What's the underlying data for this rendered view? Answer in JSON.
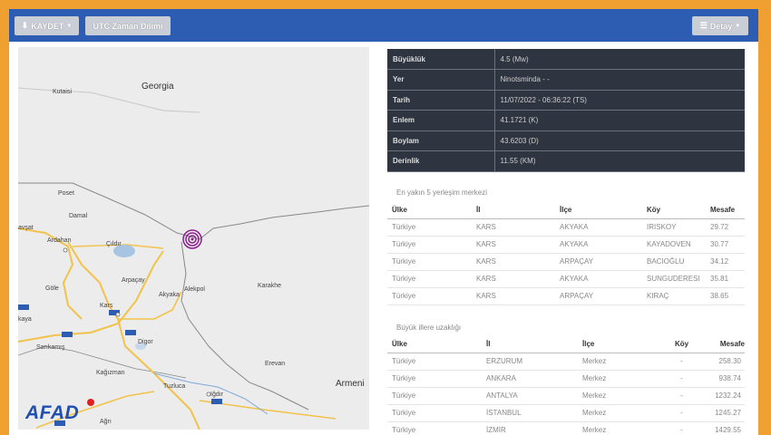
{
  "toolbar": {
    "save_label": "KAYDET",
    "utc_label": "UTC Zaman Dilimi",
    "detail_label": "Detay"
  },
  "map": {
    "labels": {
      "georgia": "Georgia",
      "kutaisi": "Kutaisi",
      "poset": "Poset",
      "damal": "Damal",
      "ardahan": "Ardahan",
      "cildir": "Çıldır",
      "arpacay": "Arpaçay",
      "akyaka": "Akyaka",
      "alaverdi": "Alekpol",
      "karakhe": "Karakhe",
      "gole": "Göle",
      "kars": "Kars",
      "sarikamis": "Sarıkamış",
      "digor": "Digor",
      "kagizman": "Kağızman",
      "tuzluca": "Tuzluca",
      "igdir": "Iğdır",
      "yerevan": "Erevan",
      "armenia": "Armeni",
      "agri": "Ağrı",
      "hanak": "Hanak",
      "posof_left": "avşat",
      "city": "kaya"
    },
    "logo": "AFAD"
  },
  "info": [
    {
      "key": "Büyüklük",
      "value": "4.5 (Mw)"
    },
    {
      "key": "Yer",
      "value": "Ninotsminda - -"
    },
    {
      "key": "Tarih",
      "value": "11/07/2022 - 06:36:22 (TS)"
    },
    {
      "key": "Enlem",
      "value": "41.1721 (K)"
    },
    {
      "key": "Boylam",
      "value": "43.6203 (D)"
    },
    {
      "key": "Derinlik",
      "value": "11.55 (KM)"
    }
  ],
  "nearest": {
    "title": "En yakın 5 yerleşim merkezi",
    "headers": [
      "Ülke",
      "İl",
      "İlçe",
      "Köy",
      "Mesafe"
    ],
    "rows": [
      [
        "Türkiye",
        "KARS",
        "AKYAKA",
        "IRISKOY",
        "29.72"
      ],
      [
        "Türkiye",
        "KARS",
        "AKYAKA",
        "KAYADOVEN",
        "30.77"
      ],
      [
        "Türkiye",
        "KARS",
        "ARPAÇAY",
        "BACIOĞLU",
        "34.12"
      ],
      [
        "Türkiye",
        "KARS",
        "AKYAKA",
        "SUNGUDERESI",
        "35.81"
      ],
      [
        "Türkiye",
        "KARS",
        "ARPAÇAY",
        "KIRAÇ",
        "38.65"
      ]
    ]
  },
  "cities": {
    "title": "Büyük illere uzaklığı",
    "headers": [
      "Ülke",
      "İl",
      "İlçe",
      "Köy",
      "Mesafe"
    ],
    "rows": [
      [
        "Türkiye",
        "ERZURUM",
        "Merkez",
        "-",
        "258.30"
      ],
      [
        "Türkiye",
        "ANKARA",
        "Merkez",
        "-",
        "938.74"
      ],
      [
        "Türkiye",
        "ANTALYA",
        "Merkez",
        "-",
        "1232.24"
      ],
      [
        "Türkiye",
        "İSTANBUL",
        "Merkez",
        "-",
        "1245.27"
      ],
      [
        "Türkiye",
        "İZMİR",
        "Merkez",
        "-",
        "1429.55"
      ]
    ]
  },
  "colors": {
    "toolbar": "#2d5db3",
    "accent_orange": "#f0a030",
    "epicenter": "#8a1f8c",
    "table_dark": "#2f3540"
  }
}
